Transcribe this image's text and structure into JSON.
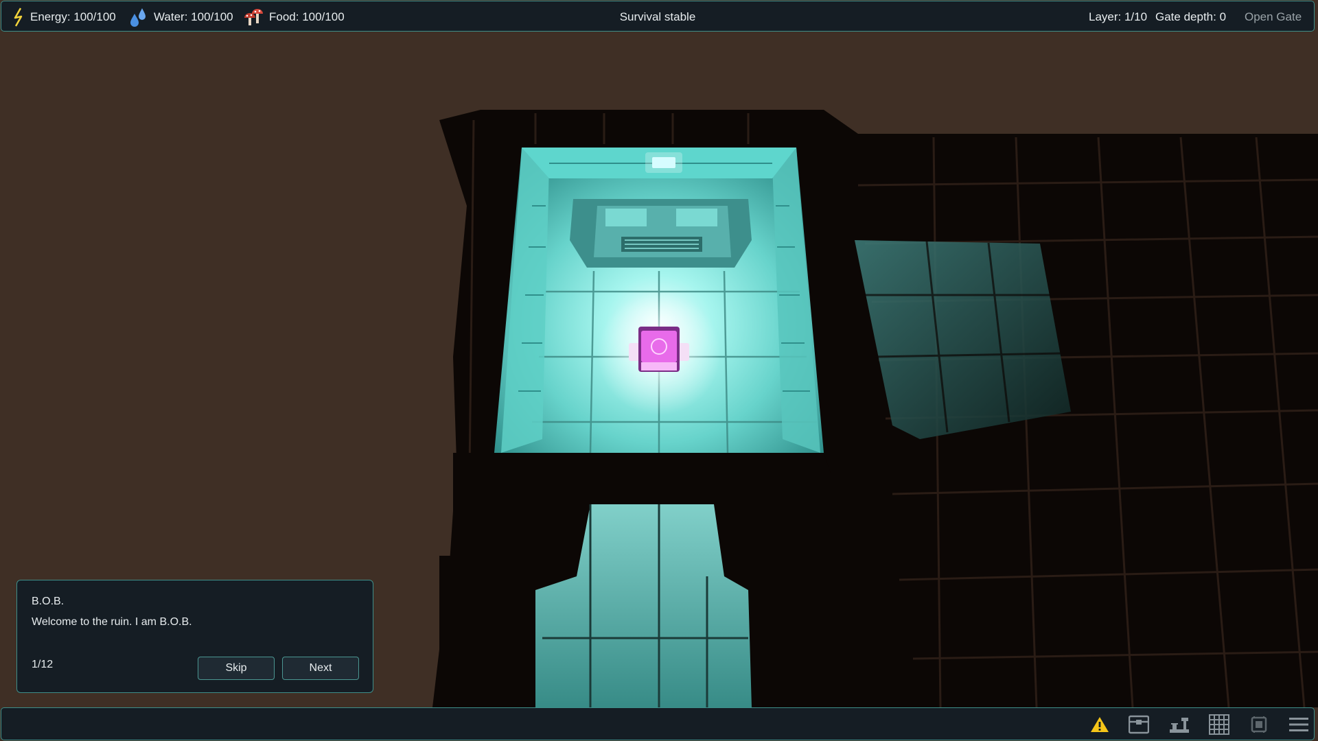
{
  "hud": {
    "energy": "Energy: 100/100",
    "water": "Water: 100/100",
    "food": "Food: 100/100",
    "status": "Survival stable",
    "layer": "Layer: 1/10",
    "gate_depth": "Gate depth: 0",
    "open_gate": "Open Gate"
  },
  "dialog": {
    "speaker": "B.O.B.",
    "message": "Welcome to the ruin. I am B.O.B.",
    "progress": "1/12",
    "skip_label": "Skip",
    "next_label": "Next"
  },
  "toolbar": {
    "items": [
      "warning-icon",
      "storage-chest-icon",
      "build-tools-icon",
      "grid-icon",
      "device-icon",
      "menu-icon"
    ]
  },
  "colors": {
    "ground": "#3f2f25",
    "panel": "#151d24",
    "panel_border": "#3e8f8a",
    "light_cyan": "#7ff0e6",
    "player_magenta": "#e55ee8",
    "energy_yellow": "#f2d33b",
    "water_blue": "#4a90e2",
    "food_red": "#c0392b",
    "warning_yellow": "#f5c518"
  }
}
